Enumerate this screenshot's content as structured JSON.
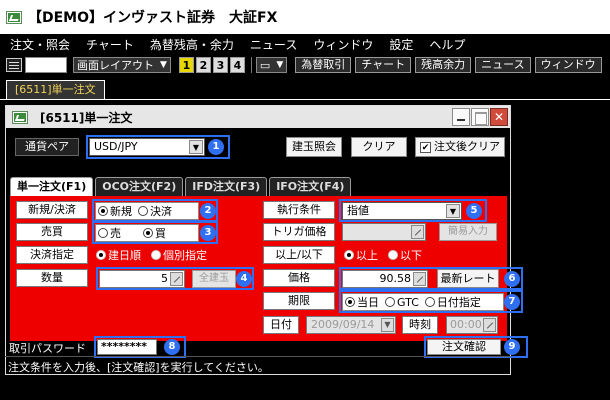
{
  "app": {
    "title": "【DEMO】インヴァスト証券　大証FX"
  },
  "menu": [
    "注文・照会",
    "チャート",
    "為替残高・余力",
    "ニュース",
    "ウィンドウ",
    "設定",
    "ヘルプ"
  ],
  "toolbar": {
    "layout_label": "画面レイアウト",
    "nums": [
      "1",
      "2",
      "3",
      "4"
    ],
    "buttons": [
      "為替取引",
      "チャート",
      "残高余力",
      "ニュース",
      "ウィンドウ"
    ]
  },
  "doc_tab": "[6511]単一注文",
  "dialog": {
    "title": "[6511]単一注文",
    "pair_label": "通貨ペア",
    "pair_value": "USD/JPY",
    "btn_position": "建玉照会",
    "btn_clear": "クリア",
    "chk_clear_after": "注文後クリア",
    "tabs": [
      "単一注文(F1)",
      "OCO注文(F2)",
      "IFD注文(F3)",
      "IFO注文(F4)"
    ],
    "left": {
      "type_label": "新規/決済",
      "type_opts": [
        "新規",
        "決済"
      ],
      "side_label": "売買",
      "side_opts": [
        "売",
        "買"
      ],
      "settle_label": "決済指定",
      "settle_opts": [
        "建日順",
        "個別指定"
      ],
      "qty_label": "数量",
      "qty_value": "5",
      "all_btn": "全建玉"
    },
    "right": {
      "cond_label": "執行条件",
      "cond_value": "指値",
      "trigger_label": "トリガ価格",
      "simple_input": "簡易入力",
      "above_label": "以上/以下",
      "above_opts": [
        "以上",
        "以下"
      ],
      "price_label": "価格",
      "price_value": "90.58",
      "rate_btn": "最新レート",
      "period_label": "期限",
      "period_opts": [
        "当日",
        "GTC",
        "日付指定"
      ],
      "date_label": "日付",
      "date_value": "2009/09/14",
      "time_label": "時刻",
      "time_value": "00:00"
    },
    "pw_label": "取引パスワード",
    "pw_value": "********",
    "confirm_btn": "注文確認",
    "badges": [
      "1",
      "2",
      "3",
      "4",
      "5",
      "6",
      "7",
      "8",
      "9"
    ]
  },
  "status": "注文条件を入力後、[注文確認]を実行してください。",
  "colors": {
    "marker": "#2f6ff2",
    "panel": "#ee0000",
    "doc_tab_text": "#f3d35a"
  }
}
